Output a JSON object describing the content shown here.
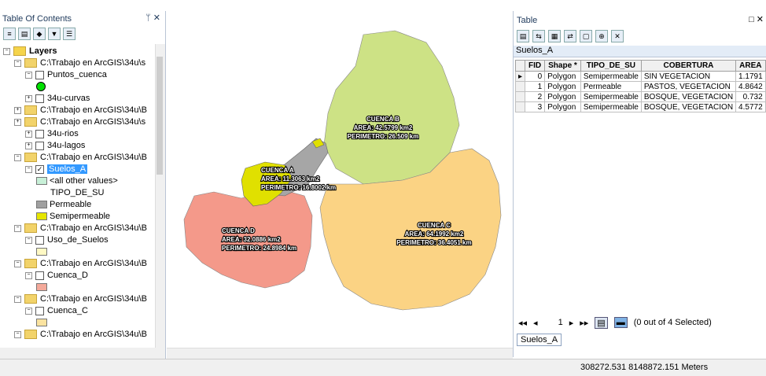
{
  "toc": {
    "title": "Table Of Contents",
    "pin": "ᛘ ✕",
    "tree": [
      {
        "indent": 0,
        "type": "root",
        "label": "Layers"
      },
      {
        "indent": 1,
        "type": "folder",
        "label": "C:\\Trabajo en ArcGIS\\34u\\s"
      },
      {
        "indent": 2,
        "type": "layer",
        "checked": false,
        "label": "Puntos_cuenca"
      },
      {
        "indent": 2,
        "type": "layer",
        "checked": false,
        "label": "34u-curvas"
      },
      {
        "indent": 1,
        "type": "folder",
        "label": "C:\\Trabajo en ArcGIS\\34u\\B"
      },
      {
        "indent": 1,
        "type": "folder",
        "label": "C:\\Trabajo en ArcGIS\\34u\\s"
      },
      {
        "indent": 2,
        "type": "layer",
        "checked": false,
        "label": "34u-rios"
      },
      {
        "indent": 2,
        "type": "layer",
        "checked": false,
        "label": "34u-lagos"
      },
      {
        "indent": 1,
        "type": "folder",
        "label": "C:\\Trabajo en ArcGIS\\34u\\B"
      },
      {
        "indent": 2,
        "type": "layer",
        "checked": true,
        "label": "Suelos_A",
        "selected": true
      },
      {
        "indent": 3,
        "type": "legend",
        "swatch": "#c8f0d8",
        "label": "<all other values>"
      },
      {
        "indent": 3,
        "type": "text",
        "label": "TIPO_DE_SU"
      },
      {
        "indent": 3,
        "type": "legend",
        "swatch": "#a0a0a0",
        "label": "Permeable"
      },
      {
        "indent": 3,
        "type": "legend",
        "swatch": "#e6e600",
        "label": "Semipermeable"
      },
      {
        "indent": 1,
        "type": "folder",
        "label": "C:\\Trabajo en ArcGIS\\34u\\B"
      },
      {
        "indent": 2,
        "type": "layer",
        "checked": false,
        "label": "Uso_de_Suelos"
      },
      {
        "indent": 3,
        "type": "swatchonly",
        "swatch": "#fff9c4"
      },
      {
        "indent": 1,
        "type": "folder",
        "label": "C:\\Trabajo en ArcGIS\\34u\\B"
      },
      {
        "indent": 2,
        "type": "layer",
        "checked": false,
        "label": "Cuenca_D"
      },
      {
        "indent": 3,
        "type": "swatchonly",
        "swatch": "#f4a99a"
      },
      {
        "indent": 1,
        "type": "folder",
        "label": "C:\\Trabajo en ArcGIS\\34u\\B"
      },
      {
        "indent": 2,
        "type": "layer",
        "checked": false,
        "label": "Cuenca_C"
      },
      {
        "indent": 3,
        "type": "swatchonly",
        "swatch": "#fbe3a0"
      },
      {
        "indent": 1,
        "type": "folder",
        "label": "C:\\Trabajo en ArcGIS\\34u\\B"
      }
    ]
  },
  "map": {
    "labels": {
      "b": [
        "CUENCA B",
        "AREA: 42.5799 km2",
        "PERIMETRO: 26.509 km"
      ],
      "a": [
        "CUENCA A",
        "AREA: 11.3063 km2",
        "PERIMETRO: 16.8002 km"
      ],
      "c": [
        "CUENCA C",
        "AREA: 64.1992 km2",
        "PERIMETRO: 36.4051 km"
      ],
      "d": [
        "CUENCA D",
        "AREA: 32.0886 km2",
        "PERIMETRO: 24.8984 km"
      ]
    },
    "colors": {
      "b": "#cde285",
      "c": "#fbd384",
      "d": "#f4998a",
      "a_yellow": "#e0e000",
      "a_gray": "#a6a6a6"
    }
  },
  "table": {
    "title": "Table",
    "layer_tab": "Suelos_A",
    "columns": [
      "FID",
      "Shape *",
      "TIPO_DE_SU",
      "COBERTURA",
      "AREA"
    ],
    "rows": [
      [
        "0",
        "Polygon",
        "Semipermeable",
        "SIN VEGETACION",
        "1.1791"
      ],
      [
        "1",
        "Polygon",
        "Permeable",
        "PASTOS, VEGETACION",
        "4.8642"
      ],
      [
        "2",
        "Polygon",
        "Semipermeable",
        "BOSQUE, VEGETACION",
        "0.732"
      ],
      [
        "3",
        "Polygon",
        "Semipermeable",
        "BOSQUE, VEGETACION",
        "4.5772"
      ]
    ],
    "record_number": "1",
    "selection_text": "(0 out of 4 Selected)",
    "bottom_tab": "Suelos_A"
  },
  "status": {
    "coords": "308272.531  8148872.151 Meters"
  }
}
